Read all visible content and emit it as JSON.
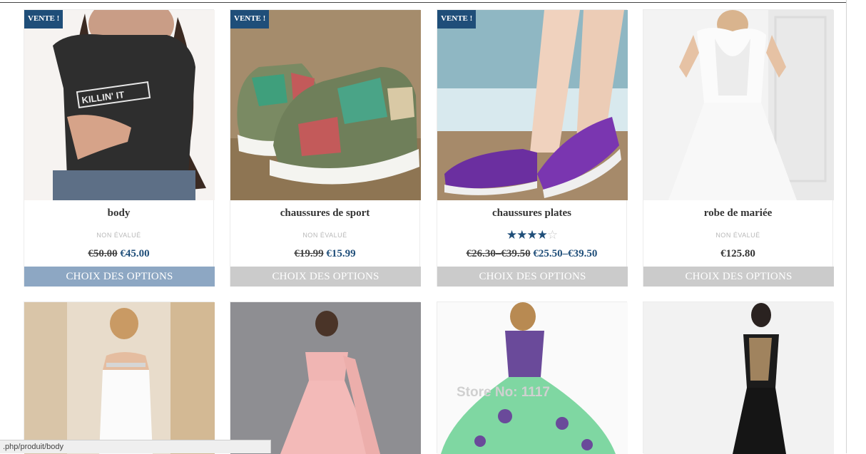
{
  "products_row1": [
    {
      "title": "body",
      "badge": "VENTE !",
      "rating_text": "NON ÉVALUÉ",
      "price_old": "€50.00",
      "price_new": "€45.00",
      "button": "CHOIX DES OPTIONS"
    },
    {
      "title": "chaussures de sport",
      "badge": "VENTE !",
      "rating_text": "NON ÉVALUÉ",
      "price_old": "€19.99",
      "price_new": "€15.99",
      "button": "CHOIX DES OPTIONS"
    },
    {
      "title": "chaussures plates",
      "badge": "VENTE !",
      "rating_value": 3.5,
      "rating_max": 5,
      "price_old": "€26.30–€39.50",
      "price_new": "€25.50–€39.50",
      "button": "CHOIX DES OPTIONS"
    },
    {
      "title": "robe de mariée",
      "rating_text": "NON ÉVALUÉ",
      "price": "€125.80",
      "button": "CHOIX DES OPTIONS"
    }
  ],
  "image_watermark": "Store No: 1117",
  "status_bar": {
    "url": ".php/produit/body"
  },
  "colors": {
    "badge": "#1f4e79",
    "price_new": "#1f4e79",
    "button_idle": "#cbcbcb",
    "button_hover": "#8da7c3"
  }
}
